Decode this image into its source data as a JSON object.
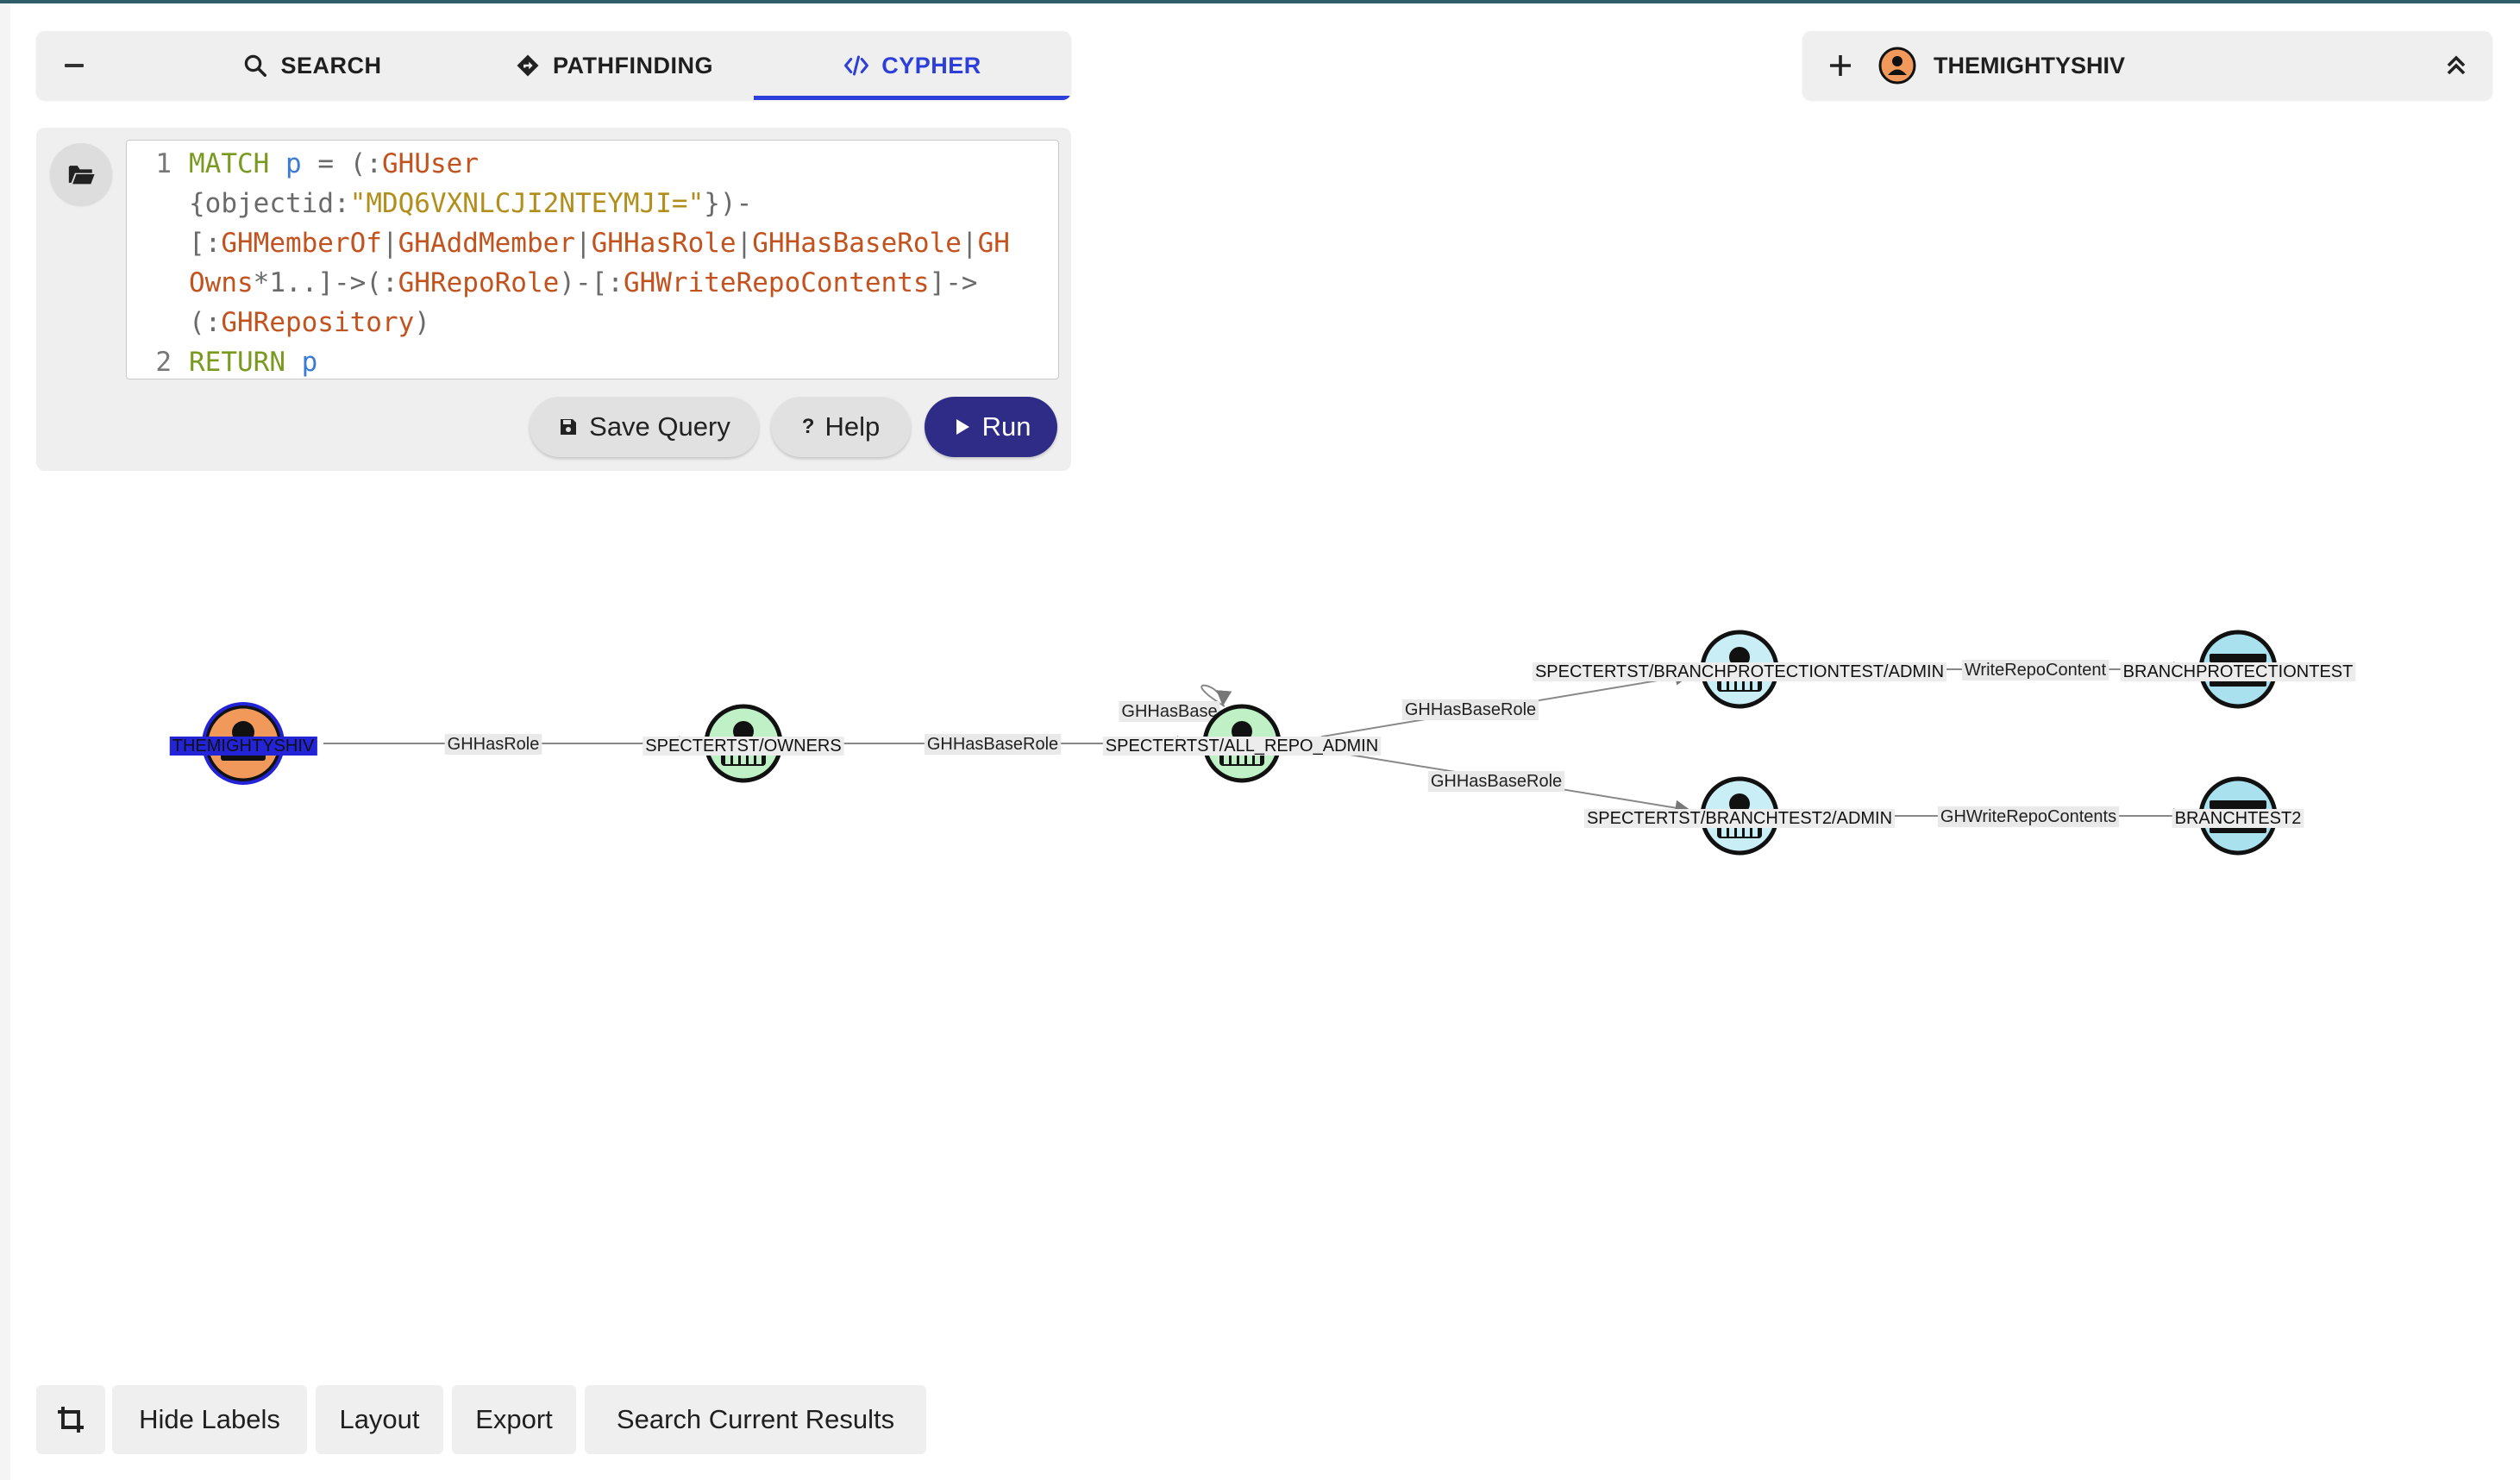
{
  "tabs": [
    {
      "label": "SEARCH",
      "icon": "search-icon"
    },
    {
      "label": "PATHFINDING",
      "icon": "route-icon"
    },
    {
      "label": "CYPHER",
      "icon": "code-icon",
      "active": true
    }
  ],
  "editor": {
    "line_numbers": [
      "1",
      "2"
    ],
    "query_lines": [
      "MATCH p = (:GHUser",
      "{objectid:\"MDQ6VXNLCJI2NTEYMJI=\"})-",
      "[:GHMemberOf|GHAddMember|GHHasRole|GHHasBaseRole|GH",
      "Owns*1..]->(:GHRepoRole)-[:GHWriteRepoContents]->",
      "(:GHRepository)",
      "RETURN p"
    ]
  },
  "buttons": {
    "save_query": "Save Query",
    "help": "Help",
    "help_glyph": "?",
    "run": "Run"
  },
  "user": {
    "name": "THEMIGHTYSHIV"
  },
  "graph": {
    "nodes": [
      {
        "id": "user",
        "label": "THEMIGHTYSHIV",
        "kind": "user",
        "color": "#f0995b",
        "highlighted": true
      },
      {
        "id": "owners",
        "label": "SPECTERTST/OWNERS",
        "kind": "team",
        "color": "#bff0c6"
      },
      {
        "id": "allrepo",
        "label": "SPECTERTST/ALL_REPO_ADMIN",
        "kind": "team",
        "color": "#bff0c6"
      },
      {
        "id": "bpt_admin",
        "label": "SPECTERTST/BRANCHPROTECTIONTEST/ADMIN",
        "kind": "repo-role",
        "color": "#c9eef5"
      },
      {
        "id": "bt2_admin",
        "label": "SPECTERTST/BRANCHTEST2/ADMIN",
        "kind": "repo-role",
        "color": "#c9eef5"
      },
      {
        "id": "bpt",
        "label": "BRANCHPROTECTIONTEST",
        "kind": "repository",
        "color": "#a9e1ee"
      },
      {
        "id": "bt2",
        "label": "BRANCHTEST2",
        "kind": "repository",
        "color": "#a9e1ee"
      }
    ],
    "edges": [
      {
        "from": "user",
        "to": "owners",
        "label": "GHHasRole"
      },
      {
        "from": "owners",
        "to": "allrepo",
        "label": "GHHasBaseRole"
      },
      {
        "from": "allrepo",
        "to": "allrepo",
        "label": "GHHasBase"
      },
      {
        "from": "allrepo",
        "to": "bpt_admin",
        "label": "GHHasBaseRole"
      },
      {
        "from": "allrepo",
        "to": "bt2_admin",
        "label": "GHHasBaseRole"
      },
      {
        "from": "bpt_admin",
        "to": "bpt",
        "label": "WriteRepoContent"
      },
      {
        "from": "bt2_admin",
        "to": "bt2",
        "label": "GHWriteRepoContents"
      }
    ]
  },
  "toolbar": {
    "hide_labels": "Hide Labels",
    "layout": "Layout",
    "export": "Export",
    "search_results": "Search Current Results"
  },
  "colors": {
    "accent": "#2d3fdb",
    "run_button": "#2f2c87",
    "highlight": "#2323d8"
  }
}
